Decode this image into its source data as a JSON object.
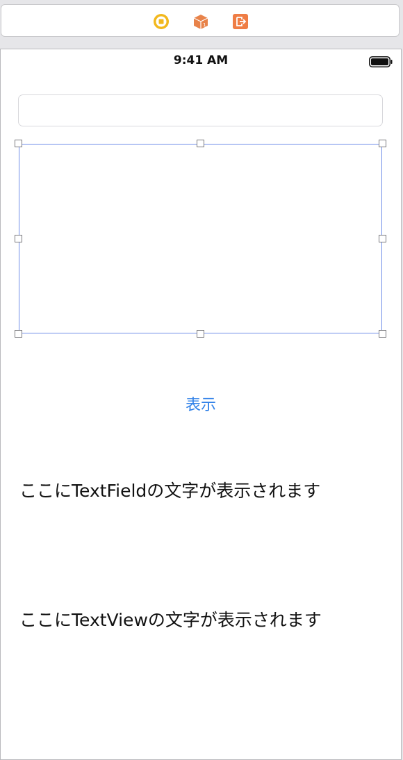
{
  "dock": {
    "icons": [
      "view-controller-icon",
      "first-responder-icon",
      "exit-icon"
    ],
    "colors": {
      "view_controller": "#f2b81d",
      "first_responder": "#e8834a",
      "exit": "#ef7d45"
    }
  },
  "status_bar": {
    "time": "9:41 AM"
  },
  "text_field": {
    "value": "",
    "placeholder": ""
  },
  "text_view": {
    "value": "",
    "selection_color": "#6e8de8"
  },
  "show_button": {
    "label": "表示",
    "color": "#2f80e8"
  },
  "labels": {
    "text_field_label": "ここにTextFieldの文字が表示されます",
    "text_view_label": "ここにTextViewの文字が表示されます"
  }
}
